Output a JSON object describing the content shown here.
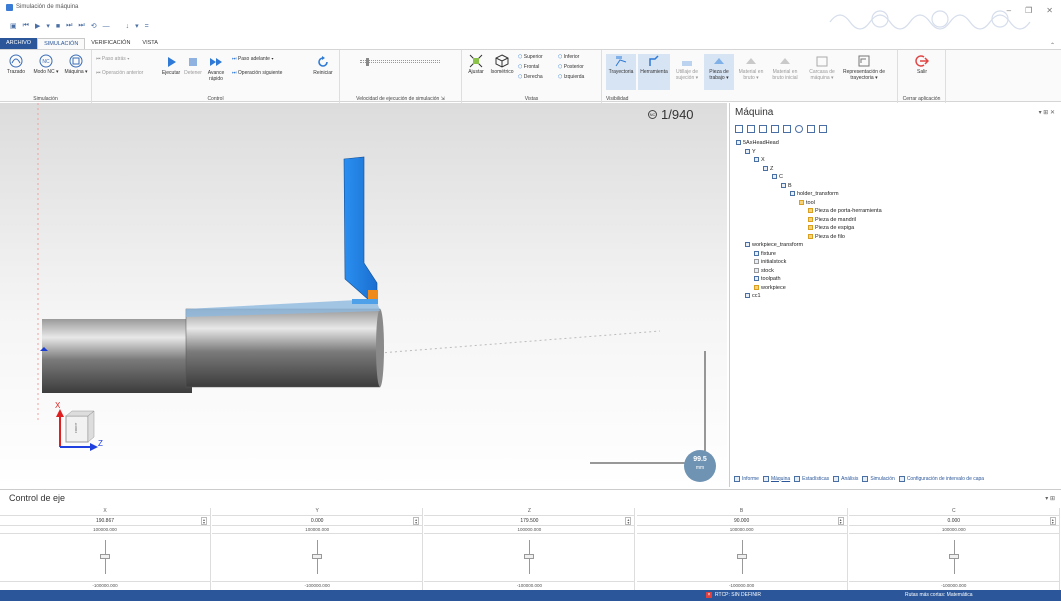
{
  "window": {
    "title": "Simulación de máquina"
  },
  "qat": [
    "▣",
    "⏮",
    "▶",
    "▾",
    "■",
    "⏭",
    "⏭",
    "⟲",
    "—",
    "↓",
    "▾",
    "="
  ],
  "window_controls": [
    "–",
    "❐",
    "✕"
  ],
  "tabs": [
    "ARCHIVO",
    "SIMULACIÓN",
    "VERIFICACIÓN",
    "VISTA"
  ],
  "ribbon": {
    "simulacion": {
      "label": "Simulación",
      "trazado": "Trazado",
      "modo_nc": "Modo NC ▾",
      "maquina": "Máquina ▾"
    },
    "control": {
      "label": "Control",
      "paso_atras": "Paso atrás ▾",
      "op_anterior": "Operación anterior",
      "ejecutar": "Ejecutar",
      "detener": "Detener",
      "avance_rapido": "Avance rápido",
      "paso_adelante": "Paso adelante ▾",
      "op_siguiente": "Operación siguiente",
      "reiniciar": "Reiniciar"
    },
    "velocidad": {
      "label": "Velocidad de ejecución de simulación"
    },
    "vistas": {
      "label": "Vistas",
      "ajustar": "Ajustar",
      "isometrico": "Isométrico",
      "superior": "Superior",
      "inferior": "Inferior",
      "frontal": "Frontal",
      "posterior": "Posterior",
      "derecha": "Derecha",
      "izquierda": "Izquierda"
    },
    "visibilidad": {
      "label": "Visibilidad",
      "trayectoria": "Trayectoria",
      "herramienta": "Herramienta",
      "utillaje": "Utillaje de sujeción ▾",
      "pieza_trabajo": "Pieza de trabajo ▾",
      "material_bruto": "Material en bruto ▾",
      "material_inicial": "Material en bruto inicial",
      "carcasa": "Carcasa de máquina ▾",
      "representacion": "Representación de trayectoria ▾"
    },
    "cerrar": {
      "label": "Cerrar aplicación",
      "salir": "Salir"
    }
  },
  "viewport": {
    "op_counter": "1/940",
    "scale_value": "99.5",
    "scale_unit": "mm",
    "axis_x": "X",
    "axis_z": "Z"
  },
  "machine_panel": {
    "title": "Máquina",
    "tree": [
      {
        "label": "5AxHeadHead",
        "depth": 0
      },
      {
        "label": "Y",
        "depth": 1
      },
      {
        "label": "X",
        "depth": 2
      },
      {
        "label": "Z",
        "depth": 3
      },
      {
        "label": "C",
        "depth": 4
      },
      {
        "label": "B",
        "depth": 5
      },
      {
        "label": "holder_transform",
        "depth": 6
      },
      {
        "label": "tool",
        "depth": 7
      },
      {
        "label": "Pieza de porta-herramienta",
        "depth": 8
      },
      {
        "label": "Pieza de mandril",
        "depth": 8
      },
      {
        "label": "Pieza de espiga",
        "depth": 8
      },
      {
        "label": "Pieza de filo",
        "depth": 8
      },
      {
        "label": "workpiece_transform",
        "depth": 1
      },
      {
        "label": "fixture",
        "depth": 2
      },
      {
        "label": "initialstock",
        "depth": 2
      },
      {
        "label": "stock",
        "depth": 2
      },
      {
        "label": "toolpath",
        "depth": 2
      },
      {
        "label": "workpiece",
        "depth": 2
      },
      {
        "label": "cc1",
        "depth": 1
      }
    ],
    "tabs": [
      "Informe",
      "Máquina",
      "Estadísticas",
      "Análisis",
      "Simulación",
      "Configuración de intervalo de capa"
    ]
  },
  "axis_control": {
    "title": "Control de eje",
    "columns": [
      {
        "name": "X",
        "value": "190.867",
        "max": "100000.000",
        "min": "-100000.000"
      },
      {
        "name": "Y",
        "value": "0.000",
        "max": "100000.000",
        "min": "-100000.000"
      },
      {
        "name": "Z",
        "value": "179.500",
        "max": "100000.000",
        "min": "-100000.000"
      },
      {
        "name": "B",
        "value": "90.000",
        "max": "100000.000",
        "min": "-100000.000"
      },
      {
        "name": "C",
        "value": "0.000",
        "max": "100000.000",
        "min": "-100000.000"
      }
    ]
  },
  "status": {
    "rtcp": "RTCP: SIN DEFINIR",
    "rutas": "Rutas más cortas: Matemática"
  }
}
